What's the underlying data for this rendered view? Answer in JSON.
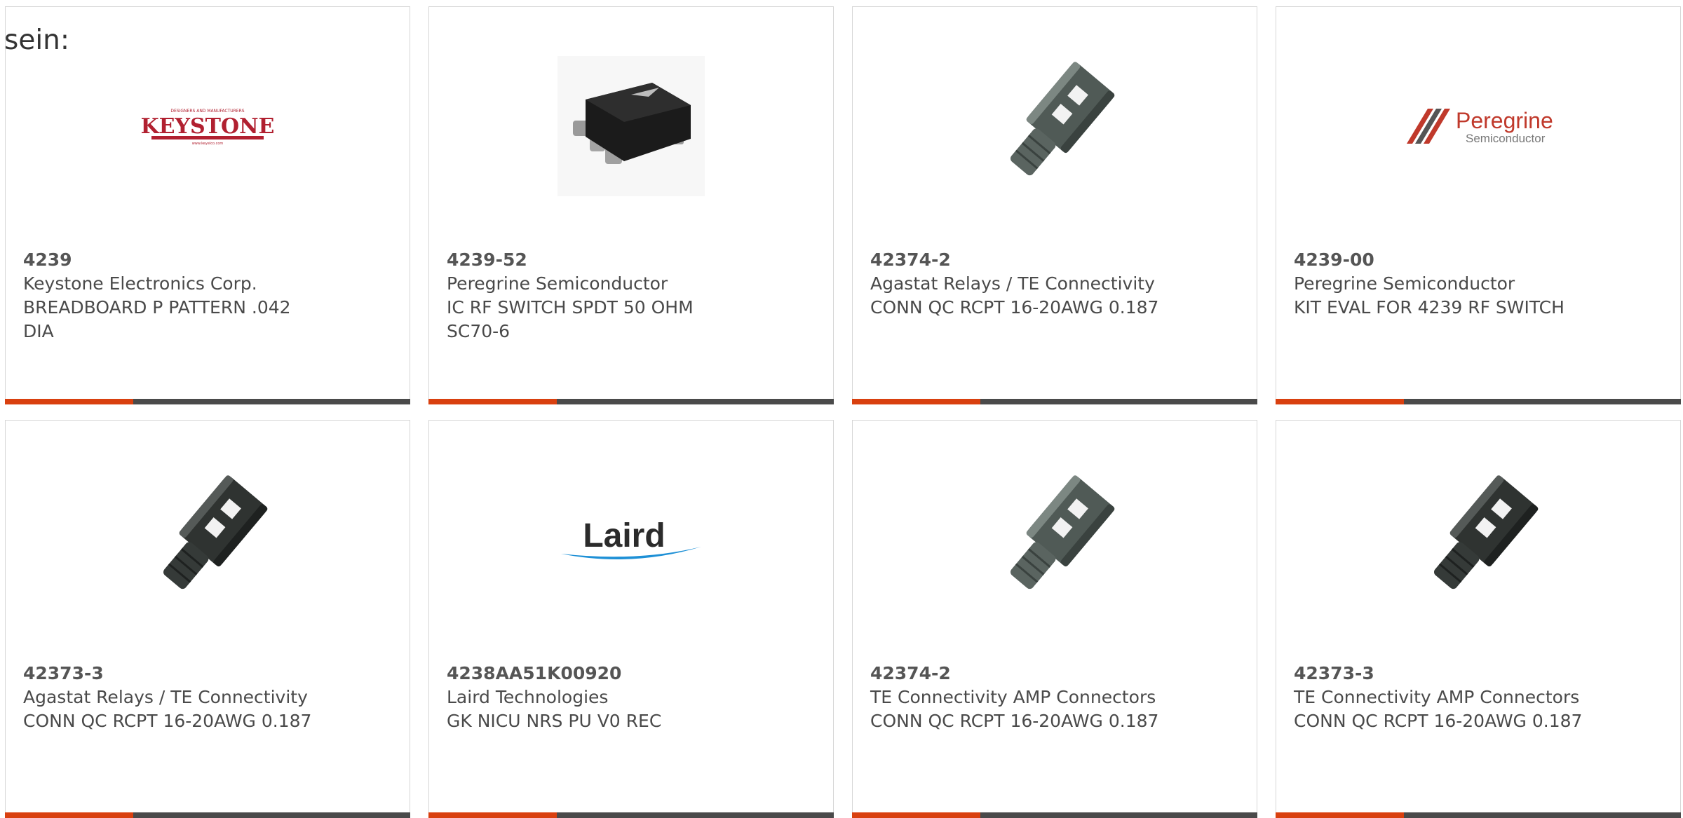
{
  "intro_text": "sein:",
  "colors": {
    "accent": "#d9400f",
    "bar": "#4a4a4a",
    "border": "#d6d6d6"
  },
  "cards": [
    {
      "part_number": "4239",
      "manufacturer": "Keystone Electronics Corp.",
      "description": "BREADBOARD P PATTERN .042 DIA",
      "image": "keystone-logo",
      "logo_text": "KEYSTONE"
    },
    {
      "part_number": "4239-52",
      "manufacturer": "Peregrine Semiconductor",
      "description": "IC RF SWITCH SPDT 50 OHM SC70-6",
      "image": "ic-chip-photo"
    },
    {
      "part_number": "42374-2",
      "manufacturer": "Agastat Relays / TE Connectivity",
      "description": "CONN QC RCPT 16-20AWG 0.187",
      "image": "connector-photo"
    },
    {
      "part_number": "4239-00",
      "manufacturer": "Peregrine Semiconductor",
      "description": "KIT EVAL FOR 4239 RF SWITCH",
      "image": "peregrine-logo",
      "logo_text": "Peregrine",
      "logo_subtext": "Semiconductor"
    },
    {
      "part_number": "42373-3",
      "manufacturer": "Agastat Relays / TE Connectivity",
      "description": "CONN QC RCPT 16-20AWG 0.187",
      "image": "connector-photo"
    },
    {
      "part_number": "4238AA51K00920",
      "manufacturer": "Laird Technologies",
      "description": "GK NICU NRS PU V0 REC",
      "image": "laird-logo",
      "logo_text": "Laird"
    },
    {
      "part_number": "42374-2",
      "manufacturer": "TE Connectivity AMP Connectors",
      "description": "CONN QC RCPT 16-20AWG 0.187",
      "image": "connector-photo"
    },
    {
      "part_number": "42373-3",
      "manufacturer": "TE Connectivity AMP Connectors",
      "description": "CONN QC RCPT 16-20AWG 0.187",
      "image": "connector-photo"
    }
  ]
}
